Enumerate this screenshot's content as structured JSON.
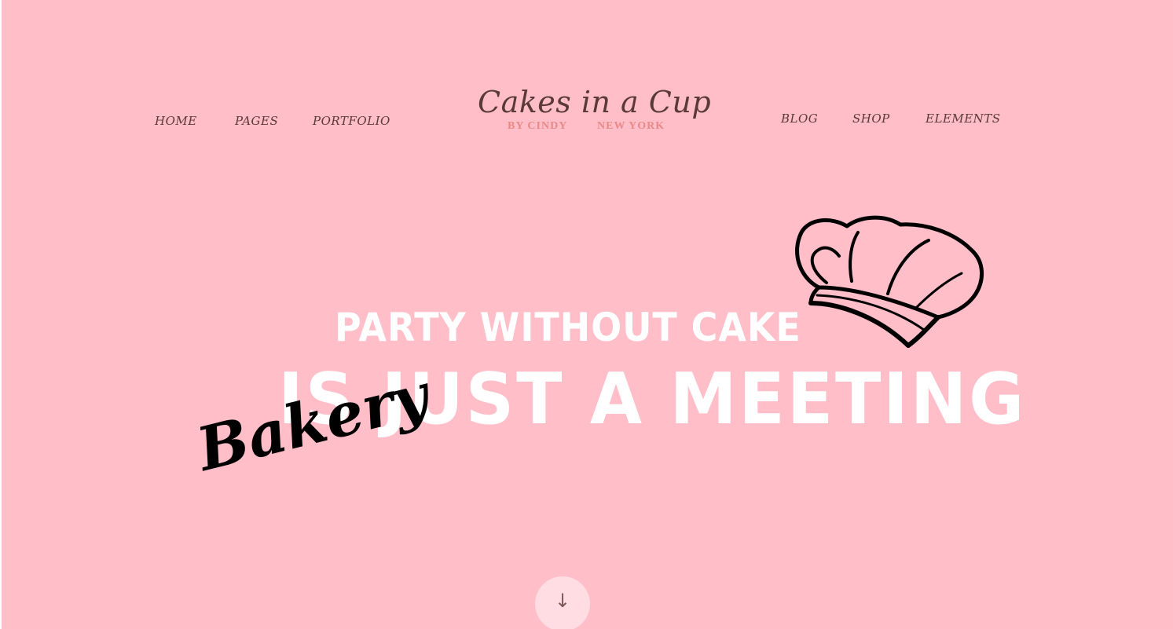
{
  "nav": {
    "left": [
      {
        "label": "HOME"
      },
      {
        "label": "PAGES"
      },
      {
        "label": "PORTFOLIO"
      }
    ],
    "right": [
      {
        "label": "BLOG"
      },
      {
        "label": "SHOP"
      },
      {
        "label": "ELEMENTS"
      }
    ]
  },
  "logo": {
    "name": "Cakes in a Cup",
    "by": "BY CINDY",
    "location": "NEW YORK"
  },
  "hero": {
    "line1": "PARTY WITHOUT CAKE",
    "line2": "IS JUST A MEETING",
    "script": "Bakery",
    "chef_hat_icon": "chef-hat-icon",
    "scroll_icon": "down-arrow-icon",
    "scroll_glyph": "↓"
  },
  "colors": {
    "background": "#ffbec8",
    "nav_text": "#5a3a38",
    "logo_accent": "#e88a88",
    "headline": "#ffffff",
    "script": "#000000"
  }
}
